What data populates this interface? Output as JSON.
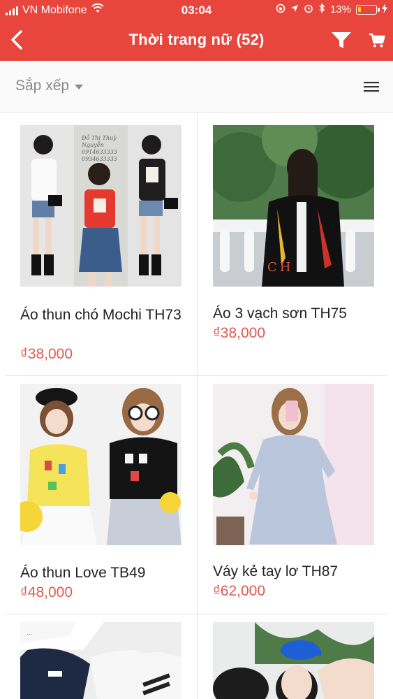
{
  "status_bar": {
    "carrier": "VN Mobifone",
    "time": "03:04",
    "battery": "13%"
  },
  "nav": {
    "title": "Thời trang nữ (52)"
  },
  "sort": {
    "label": "Sắp xếp"
  },
  "products": [
    {
      "name": "Áo thun chó Mochi TH73",
      "price": "₫38,000"
    },
    {
      "name": "Áo 3 vạch sơn TH75",
      "price": "₫38,000"
    },
    {
      "name": "Áo thun Love TB49",
      "price": "₫48,000"
    },
    {
      "name": "Váy kẻ tay lơ TH87",
      "price": "₫62,000"
    },
    {
      "name": "",
      "price": ""
    },
    {
      "name": "",
      "price": ""
    }
  ],
  "image_overlay_texts": {
    "product_1": [
      "Đỗ Thị Thuỳ Nguyễn",
      "0914633333",
      "0934633333"
    ],
    "product_2": [
      "CH"
    ]
  },
  "colors": {
    "header_bg": "#e8453c",
    "price": "#e05a4e",
    "sort_text": "#8a8a8a"
  },
  "icons": [
    "back-chevron-icon",
    "filter-funnel-icon",
    "cart-icon",
    "hamburger-list-icon",
    "dropdown-caret-icon",
    "wifi-icon",
    "signal-icon",
    "battery-icon"
  ]
}
